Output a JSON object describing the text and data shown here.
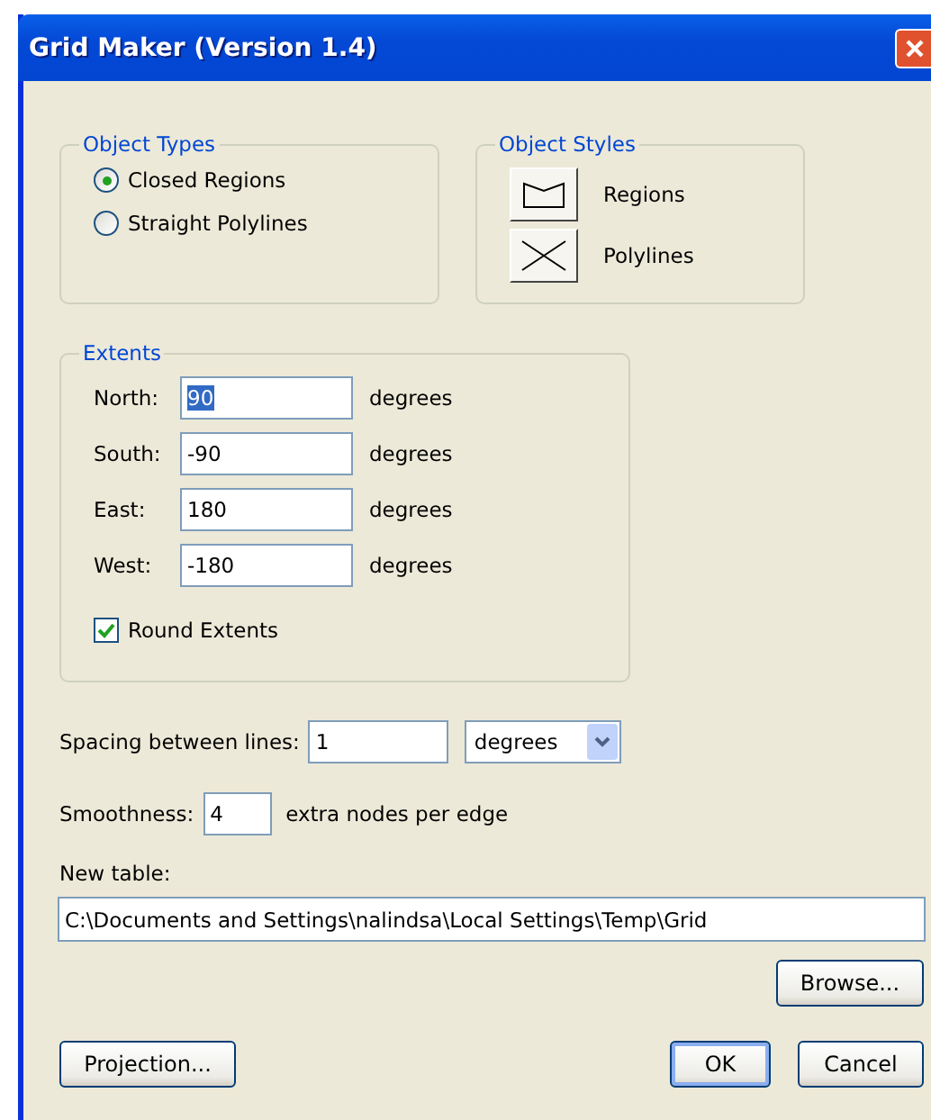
{
  "window": {
    "title": "Grid Maker (Version 1.4)"
  },
  "object_types": {
    "label": "Object Types",
    "options": [
      {
        "label": "Closed Regions",
        "selected": true
      },
      {
        "label": "Straight Polylines",
        "selected": false
      }
    ]
  },
  "object_styles": {
    "label": "Object Styles",
    "items": [
      {
        "kind": "region",
        "label": "Regions"
      },
      {
        "kind": "polyline",
        "label": "Polylines"
      }
    ]
  },
  "extents": {
    "label": "Extents",
    "fields": [
      {
        "label": "North:",
        "value": "90",
        "unit": "degrees",
        "highlighted": true
      },
      {
        "label": "South:",
        "value": "-90",
        "unit": "degrees",
        "highlighted": false
      },
      {
        "label": "East:",
        "value": "180",
        "unit": "degrees",
        "highlighted": false
      },
      {
        "label": "West:",
        "value": "-180",
        "unit": "degrees",
        "highlighted": false
      }
    ],
    "round_extents": {
      "label": "Round Extents",
      "checked": true
    }
  },
  "spacing": {
    "label": "Spacing between lines:",
    "value": "1",
    "unit": "degrees"
  },
  "smoothness": {
    "label": "Smoothness:",
    "value": "4",
    "suffix": "extra nodes per edge"
  },
  "new_table": {
    "label": "New table:",
    "value": "C:\\Documents and Settings\\nalindsa\\Local Settings\\Temp\\Grid"
  },
  "buttons": [
    {
      "kind": "browse",
      "label": "Browse..."
    },
    {
      "kind": "projection",
      "label": "Projection..."
    },
    {
      "kind": "ok",
      "label": "OK",
      "default": true
    },
    {
      "kind": "cancel",
      "label": "Cancel",
      "default": false
    }
  ]
}
